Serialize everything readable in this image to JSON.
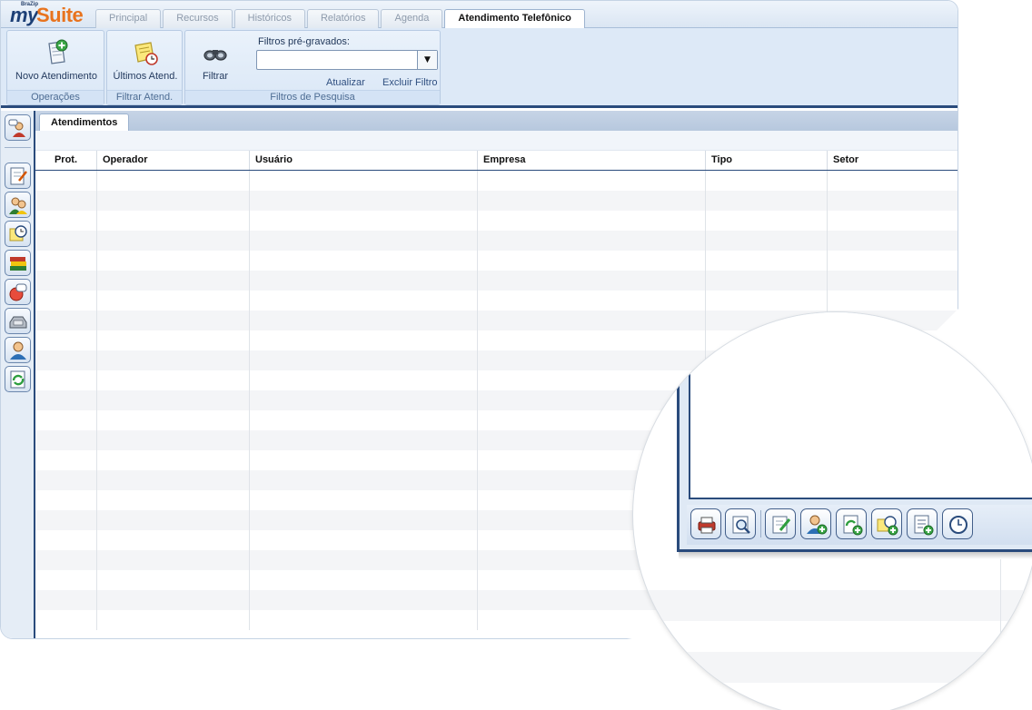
{
  "app": {
    "brand_small": "BraZip",
    "brand_my": "my",
    "brand_suite": "Suite"
  },
  "tabs": [
    {
      "label": "Principal",
      "active": false
    },
    {
      "label": "Recursos",
      "active": false
    },
    {
      "label": "Históricos",
      "active": false
    },
    {
      "label": "Relatórios",
      "active": false
    },
    {
      "label": "Agenda",
      "active": false
    },
    {
      "label": "Atendimento Telefônico",
      "active": true
    }
  ],
  "ribbon": {
    "operacoes": {
      "label": "Operações",
      "novo_atendimento": "Novo Atendimento"
    },
    "filtrar_atend": {
      "label": "Filtrar Atend.",
      "ultimos_atend": "Últimos Atend."
    },
    "filtros_pesquisa": {
      "label": "Filtros de Pesquisa",
      "filtrar": "Filtrar",
      "filtros_label": "Filtros pré-gravados:",
      "filtros_value": "",
      "atualizar": "Atualizar",
      "excluir_filtro": "Excluir Filtro"
    }
  },
  "document": {
    "tab_label": "Atendimentos"
  },
  "grid": {
    "columns": [
      "Prot.",
      "Operador",
      "Usuário",
      "Empresa",
      "Tipo",
      "Setor"
    ],
    "rows": []
  },
  "colors": {
    "accent": "#2a4b7c",
    "ribbon": "#dde9f7",
    "logo_orange": "#e8731e",
    "logo_blue": "#1c3f76"
  },
  "sidebar_icons": [
    "user-chat-icon",
    "notepad-icon",
    "users-icon",
    "clock-notes-icon",
    "books-icon",
    "user-chat-red-icon",
    "phone-icon",
    "person-icon",
    "refresh-doc-icon"
  ],
  "magnifier_icons": [
    "print-icon",
    "preview-icon",
    "edit-icon",
    "add-user-icon",
    "add-refresh-icon",
    "add-clock-icon",
    "add-list-icon",
    "clock-icon"
  ]
}
